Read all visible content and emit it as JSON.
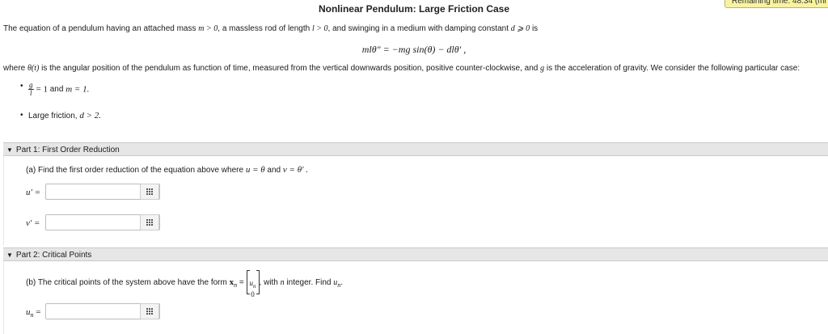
{
  "timer": {
    "text": "Remaining time: 48:34 (mi"
  },
  "title": "Nonlinear Pendulum: Large Friction Case",
  "intro": {
    "a": "The equation of a pendulum having an attached mass ",
    "m_cond": "m > 0",
    "b": ", a massless rod of length ",
    "l_cond": "l > 0",
    "c": ", and swinging in a medium with damping constant ",
    "d_cond": "d ⩾ 0",
    "d": " is"
  },
  "equation": "mlθ″ = −mg sin(θ) − dlθ′ ,",
  "defs": {
    "a": "where ",
    "theta": "θ(t)",
    "b": " is the angular position of the pendulum as function of time, measured from the vertical downwards position, positive counter-clockwise, and ",
    "g": "g",
    "c": " is the acceleration of gravity. We consider the following particular case:"
  },
  "bullets": {
    "one_frac_num": "g",
    "one_frac_den": "l",
    "one_eq": "= 1",
    "one_and": " and ",
    "one_m": "m = 1.",
    "two_text": "Large friction, ",
    "two_math": "d > 2."
  },
  "part1": {
    "heading": "Part 1: First Order Reduction",
    "question_a": "(a) Find the first order reduction of the equation above where ",
    "question_u": "u = θ",
    "question_and": " and ",
    "question_v": "v = θ′ .",
    "u_label": "u′ =",
    "v_label": "v′ ="
  },
  "part2": {
    "heading": "Part 2: Critical Points",
    "question_a": "(b) The critical points of the system above have the form ",
    "xn": "x",
    "xn_sub": "n",
    "eq": " = ",
    "vec_top": "u",
    "vec_top_sub": "n",
    "vec_bottom": "0",
    "question_b": ", with ",
    "n": "n",
    "question_c": " integer. Find ",
    "un": "u",
    "un_sub": "n",
    "question_d": ".",
    "un_label": "u",
    "un_label_sub": "n",
    "un_eq": " ="
  },
  "icons": {
    "matrix_button": "matrix-grid-icon",
    "collapse": "triangle-down-icon"
  }
}
